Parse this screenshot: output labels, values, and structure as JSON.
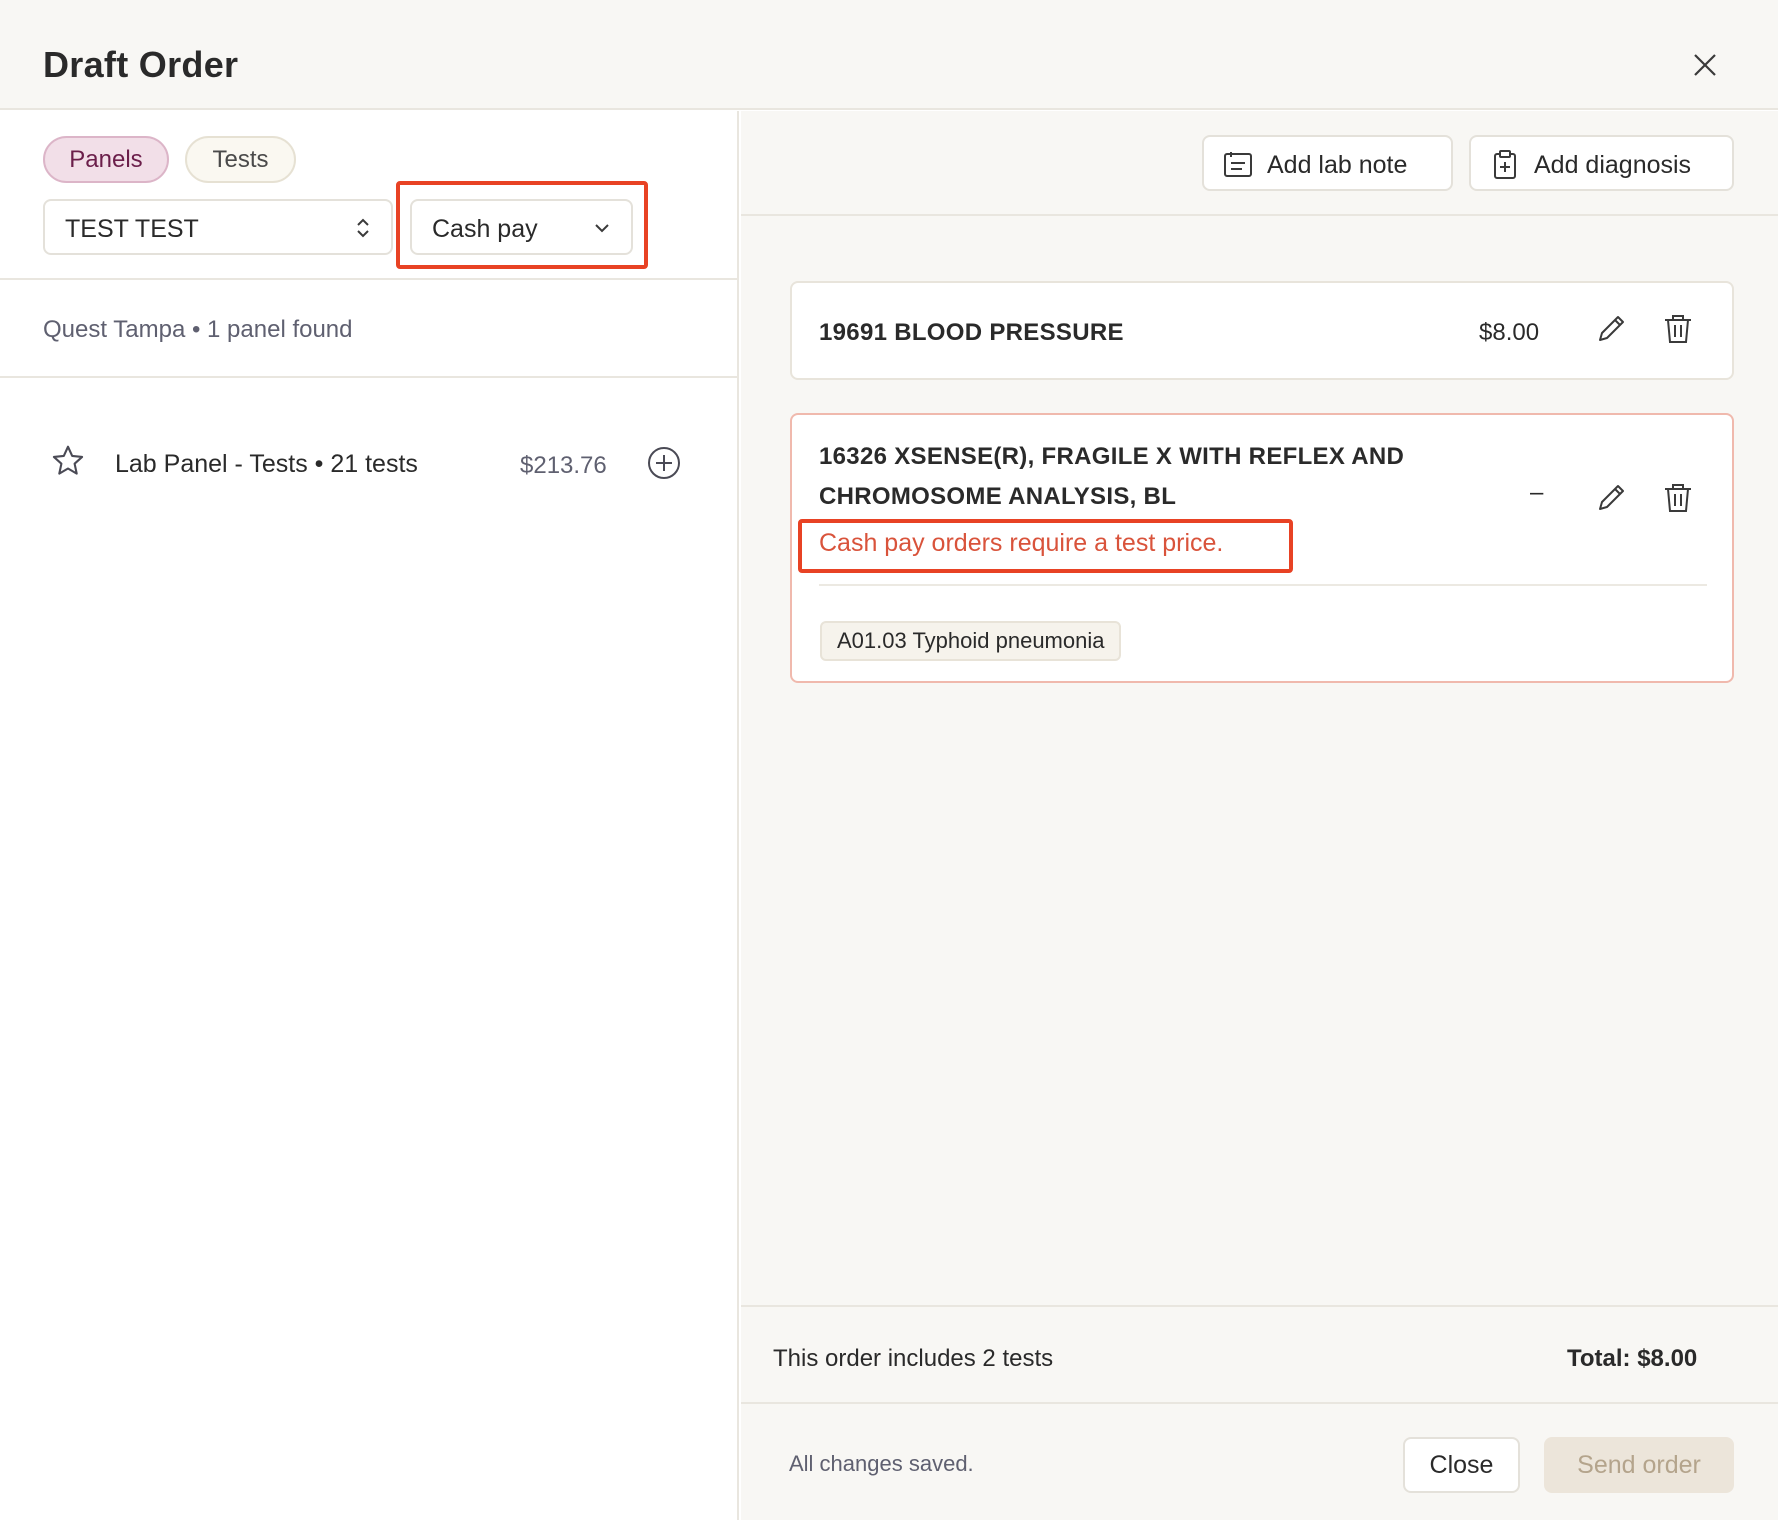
{
  "header": {
    "title": "Draft Order"
  },
  "left": {
    "toggle": {
      "panels_label": "Panels",
      "tests_label": "Tests",
      "active": "Panels"
    },
    "patient_select": {
      "value": "TEST TEST"
    },
    "payment_select": {
      "value": "Cash pay"
    },
    "lab_info": "Quest Tampa • 1 panel found",
    "panels": [
      {
        "name": "Lab Panel - Tests • 21 tests",
        "price": "$213.76"
      }
    ]
  },
  "right": {
    "actions": {
      "add_lab_note": "Add lab note",
      "add_diagnosis": "Add diagnosis"
    },
    "tests": [
      {
        "name": "19691 BLOOD PRESSURE",
        "price": "$8.00"
      },
      {
        "name_line1": "16326 XSENSE(R), FRAGILE X WITH REFLEX AND",
        "name_line2": "CHROMOSOME ANALYSIS, BL",
        "price": "–",
        "error": "Cash pay orders require a test price.",
        "diagnosis": "A01.03 Typhoid pneumonia"
      }
    ],
    "summary": {
      "count_text": "This order includes 2 tests",
      "total_text": "Total: $8.00"
    },
    "footer": {
      "saved_text": "All changes saved.",
      "close_label": "Close",
      "send_label": "Send order"
    }
  },
  "colors": {
    "accent_error": "#d9533b",
    "annotation_red": "#e84224",
    "panels_active_bg": "#f2dfe8",
    "send_disabled_bg": "#ece5da"
  }
}
